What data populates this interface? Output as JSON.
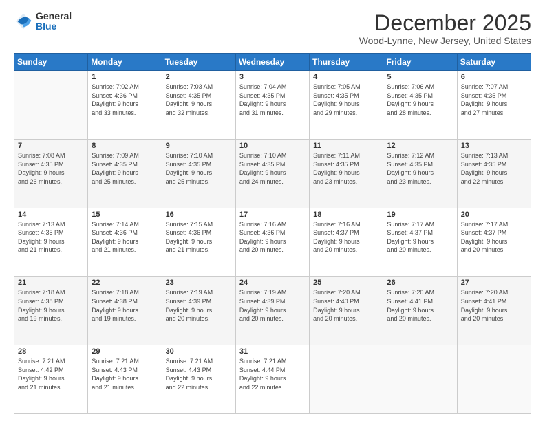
{
  "logo": {
    "general": "General",
    "blue": "Blue"
  },
  "title": "December 2025",
  "subtitle": "Wood-Lynne, New Jersey, United States",
  "days_of_week": [
    "Sunday",
    "Monday",
    "Tuesday",
    "Wednesday",
    "Thursday",
    "Friday",
    "Saturday"
  ],
  "weeks": [
    [
      {
        "day": "",
        "info": ""
      },
      {
        "day": "1",
        "info": "Sunrise: 7:02 AM\nSunset: 4:36 PM\nDaylight: 9 hours\nand 33 minutes."
      },
      {
        "day": "2",
        "info": "Sunrise: 7:03 AM\nSunset: 4:35 PM\nDaylight: 9 hours\nand 32 minutes."
      },
      {
        "day": "3",
        "info": "Sunrise: 7:04 AM\nSunset: 4:35 PM\nDaylight: 9 hours\nand 31 minutes."
      },
      {
        "day": "4",
        "info": "Sunrise: 7:05 AM\nSunset: 4:35 PM\nDaylight: 9 hours\nand 29 minutes."
      },
      {
        "day": "5",
        "info": "Sunrise: 7:06 AM\nSunset: 4:35 PM\nDaylight: 9 hours\nand 28 minutes."
      },
      {
        "day": "6",
        "info": "Sunrise: 7:07 AM\nSunset: 4:35 PM\nDaylight: 9 hours\nand 27 minutes."
      }
    ],
    [
      {
        "day": "7",
        "info": "Sunrise: 7:08 AM\nSunset: 4:35 PM\nDaylight: 9 hours\nand 26 minutes."
      },
      {
        "day": "8",
        "info": "Sunrise: 7:09 AM\nSunset: 4:35 PM\nDaylight: 9 hours\nand 25 minutes."
      },
      {
        "day": "9",
        "info": "Sunrise: 7:10 AM\nSunset: 4:35 PM\nDaylight: 9 hours\nand 25 minutes."
      },
      {
        "day": "10",
        "info": "Sunrise: 7:10 AM\nSunset: 4:35 PM\nDaylight: 9 hours\nand 24 minutes."
      },
      {
        "day": "11",
        "info": "Sunrise: 7:11 AM\nSunset: 4:35 PM\nDaylight: 9 hours\nand 23 minutes."
      },
      {
        "day": "12",
        "info": "Sunrise: 7:12 AM\nSunset: 4:35 PM\nDaylight: 9 hours\nand 23 minutes."
      },
      {
        "day": "13",
        "info": "Sunrise: 7:13 AM\nSunset: 4:35 PM\nDaylight: 9 hours\nand 22 minutes."
      }
    ],
    [
      {
        "day": "14",
        "info": "Sunrise: 7:13 AM\nSunset: 4:35 PM\nDaylight: 9 hours\nand 21 minutes."
      },
      {
        "day": "15",
        "info": "Sunrise: 7:14 AM\nSunset: 4:36 PM\nDaylight: 9 hours\nand 21 minutes."
      },
      {
        "day": "16",
        "info": "Sunrise: 7:15 AM\nSunset: 4:36 PM\nDaylight: 9 hours\nand 21 minutes."
      },
      {
        "day": "17",
        "info": "Sunrise: 7:16 AM\nSunset: 4:36 PM\nDaylight: 9 hours\nand 20 minutes."
      },
      {
        "day": "18",
        "info": "Sunrise: 7:16 AM\nSunset: 4:37 PM\nDaylight: 9 hours\nand 20 minutes."
      },
      {
        "day": "19",
        "info": "Sunrise: 7:17 AM\nSunset: 4:37 PM\nDaylight: 9 hours\nand 20 minutes."
      },
      {
        "day": "20",
        "info": "Sunrise: 7:17 AM\nSunset: 4:37 PM\nDaylight: 9 hours\nand 20 minutes."
      }
    ],
    [
      {
        "day": "21",
        "info": "Sunrise: 7:18 AM\nSunset: 4:38 PM\nDaylight: 9 hours\nand 19 minutes."
      },
      {
        "day": "22",
        "info": "Sunrise: 7:18 AM\nSunset: 4:38 PM\nDaylight: 9 hours\nand 19 minutes."
      },
      {
        "day": "23",
        "info": "Sunrise: 7:19 AM\nSunset: 4:39 PM\nDaylight: 9 hours\nand 20 minutes."
      },
      {
        "day": "24",
        "info": "Sunrise: 7:19 AM\nSunset: 4:39 PM\nDaylight: 9 hours\nand 20 minutes."
      },
      {
        "day": "25",
        "info": "Sunrise: 7:20 AM\nSunset: 4:40 PM\nDaylight: 9 hours\nand 20 minutes."
      },
      {
        "day": "26",
        "info": "Sunrise: 7:20 AM\nSunset: 4:41 PM\nDaylight: 9 hours\nand 20 minutes."
      },
      {
        "day": "27",
        "info": "Sunrise: 7:20 AM\nSunset: 4:41 PM\nDaylight: 9 hours\nand 20 minutes."
      }
    ],
    [
      {
        "day": "28",
        "info": "Sunrise: 7:21 AM\nSunset: 4:42 PM\nDaylight: 9 hours\nand 21 minutes."
      },
      {
        "day": "29",
        "info": "Sunrise: 7:21 AM\nSunset: 4:43 PM\nDaylight: 9 hours\nand 21 minutes."
      },
      {
        "day": "30",
        "info": "Sunrise: 7:21 AM\nSunset: 4:43 PM\nDaylight: 9 hours\nand 22 minutes."
      },
      {
        "day": "31",
        "info": "Sunrise: 7:21 AM\nSunset: 4:44 PM\nDaylight: 9 hours\nand 22 minutes."
      },
      {
        "day": "",
        "info": ""
      },
      {
        "day": "",
        "info": ""
      },
      {
        "day": "",
        "info": ""
      }
    ]
  ]
}
